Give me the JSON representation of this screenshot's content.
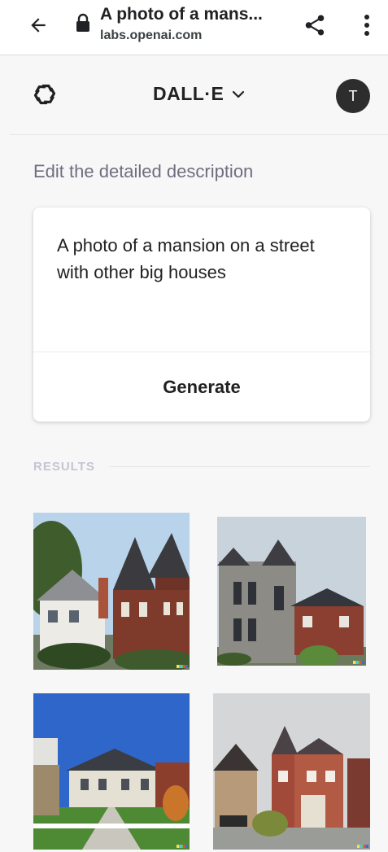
{
  "browser": {
    "title": "A photo of a mans...",
    "url": "labs.openai.com",
    "icons": [
      "back-arrow-icon",
      "lock-icon",
      "share-icon",
      "more-vert-icon"
    ]
  },
  "app": {
    "product_name": "DALL·E",
    "avatar_initial": "T",
    "icons": [
      "openai-logo-icon",
      "chevron-down-icon"
    ]
  },
  "editor": {
    "heading": "Edit the detailed description",
    "prompt_value": "A photo of a mansion on a street with other big houses",
    "generate_label": "Generate"
  },
  "results": {
    "label": "RESULTS",
    "images": [
      {
        "description": "brick mansion with turrets next to a white house, trees on left"
      },
      {
        "description": "stone gothic mansion beside red brick house with dark roof"
      },
      {
        "description": "white mansion with dark roof, green lawn, blue sky"
      },
      {
        "description": "brick victorian house with tower and neighboring houses, grey sky"
      }
    ]
  },
  "colors": {
    "accent_text": "#202123",
    "muted_text": "#6e6e80",
    "page_bg": "#f7f7f8",
    "avatar_bg": "#2d2d2d",
    "results_label": "#c5c5d2"
  }
}
